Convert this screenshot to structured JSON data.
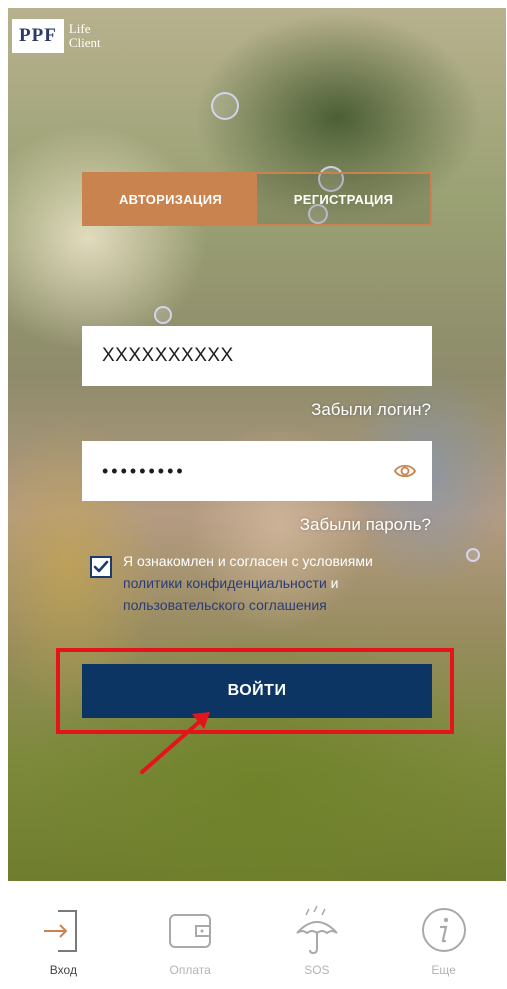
{
  "logo": {
    "mark": "PPF",
    "line1": "Life",
    "line2": "Client"
  },
  "tabs": [
    {
      "label": "АВТОРИЗАЦИЯ",
      "active": true
    },
    {
      "label": "РЕГИСТРАЦИЯ",
      "active": false
    }
  ],
  "login": {
    "value": "XXXXXXXXXX",
    "forgot_label": "Забыли логин?"
  },
  "password": {
    "value": "•••••••••",
    "forgot_label": "Забыли пароль?",
    "toggle_icon": "eye-icon"
  },
  "consent": {
    "checked": true,
    "text_plain": "Я ознакомлен и согласен с условиями ",
    "link_privacy": "политики конфиденциальности",
    "text_and": " и ",
    "link_terms": "пользовательского соглашения"
  },
  "submit": {
    "label": "ВОЙТИ"
  },
  "nav": [
    {
      "label": "Вход",
      "icon": "login-door-icon",
      "active": true
    },
    {
      "label": "Оплата",
      "icon": "wallet-icon",
      "active": false
    },
    {
      "label": "SOS",
      "icon": "umbrella-icon",
      "active": false
    },
    {
      "label": "Еще",
      "icon": "info-icon",
      "active": false
    }
  ],
  "colors": {
    "accent": "#c9834f",
    "primary_button": "#0d3564",
    "highlight_box": "#e4141b",
    "link": "#2a3c77",
    "nav_accent": "#c9834f"
  }
}
